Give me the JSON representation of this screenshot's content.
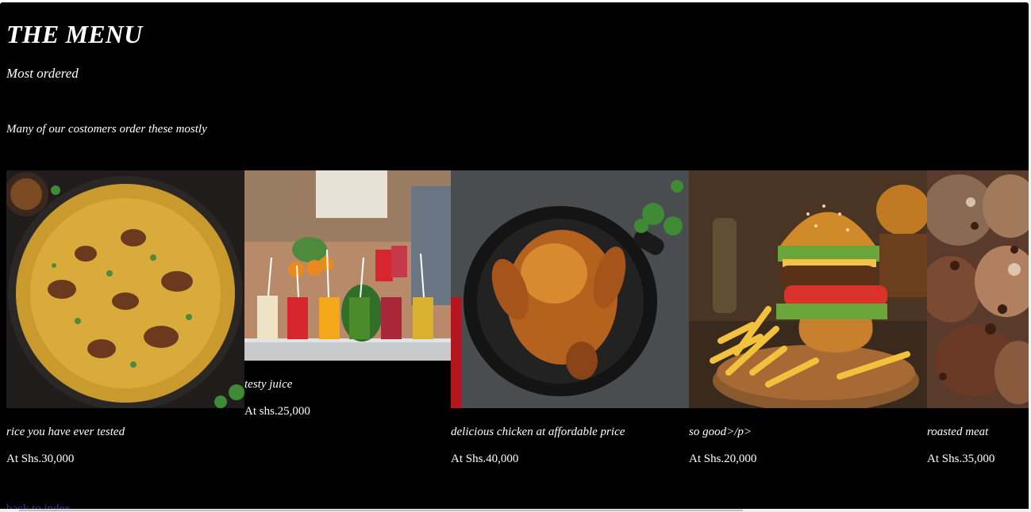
{
  "page": {
    "title": "THE MENU",
    "subtitle": "Most ordered",
    "intro": "Many of our costomers order these mostly"
  },
  "items": [
    {
      "caption": "rice you have ever tested",
      "price": "At Shs.30,000",
      "image": "biryani-rice-photo"
    },
    {
      "caption": "testy juice",
      "price": "At shs.25,000",
      "image": "juice-stand-photo"
    },
    {
      "caption": "delicious chicken at affordable price",
      "price": "At Shs.40,000",
      "image": "roast-chicken-photo"
    },
    {
      "caption": "so good>/p>",
      "price": "At Shs.20,000",
      "image": "burger-fries-photo"
    },
    {
      "caption": "roasted meat",
      "price": "At Shs.35,000",
      "image": "roasted-meat-photo"
    }
  ],
  "footer": {
    "back_link": "back to index"
  },
  "colors": {
    "background": "#000000",
    "text": "#ffffff",
    "link": "#4b2aa6"
  }
}
